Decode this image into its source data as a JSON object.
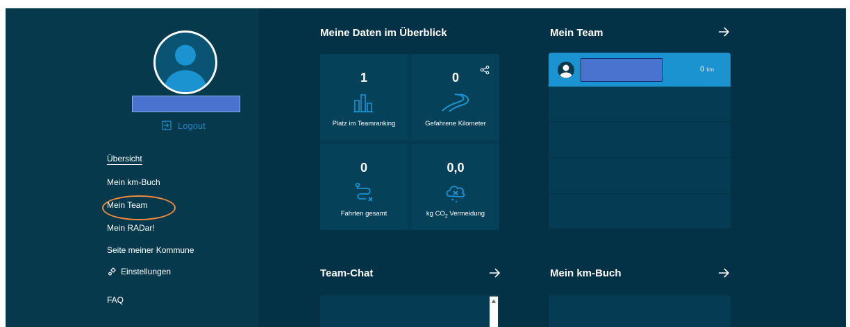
{
  "sidebar": {
    "logout_label": "Logout",
    "nav": [
      {
        "label": "Übersicht",
        "active": true
      },
      {
        "label": "Mein km-Buch"
      },
      {
        "label": "Mein Team"
      },
      {
        "label": "Mein RADar!"
      },
      {
        "label": "Seite meiner Kommune"
      },
      {
        "label": "Einstellungen",
        "icon": "gears-icon"
      },
      {
        "label": "FAQ"
      }
    ]
  },
  "overview": {
    "title": "Meine Daten im Überblick",
    "stats": [
      {
        "value": "1",
        "label": "Platz im Teamranking",
        "icon": "bar-chart-icon"
      },
      {
        "value": "0",
        "label": "Gefahrene Kilometer",
        "icon": "road-icon",
        "share_icon": "share-icon"
      },
      {
        "value": "0",
        "label": "Fahrten gesamt",
        "icon": "route-icon"
      },
      {
        "value": "0,0",
        "label_prefix": "kg CO",
        "label_sub": "2",
        "label_suffix": " Vermeidung",
        "icon": "co2-cloud-icon"
      }
    ]
  },
  "team": {
    "title": "Mein Team",
    "rows": [
      {
        "km_value": "0",
        "km_unit": "km"
      }
    ]
  },
  "chat": {
    "title": "Team-Chat"
  },
  "kmbuch": {
    "title": "Mein km-Buch"
  },
  "colors": {
    "background": "#053a4e",
    "accent": "#1a93d0",
    "highlight": "#f28c3a",
    "redaction": "#4a73cf"
  }
}
